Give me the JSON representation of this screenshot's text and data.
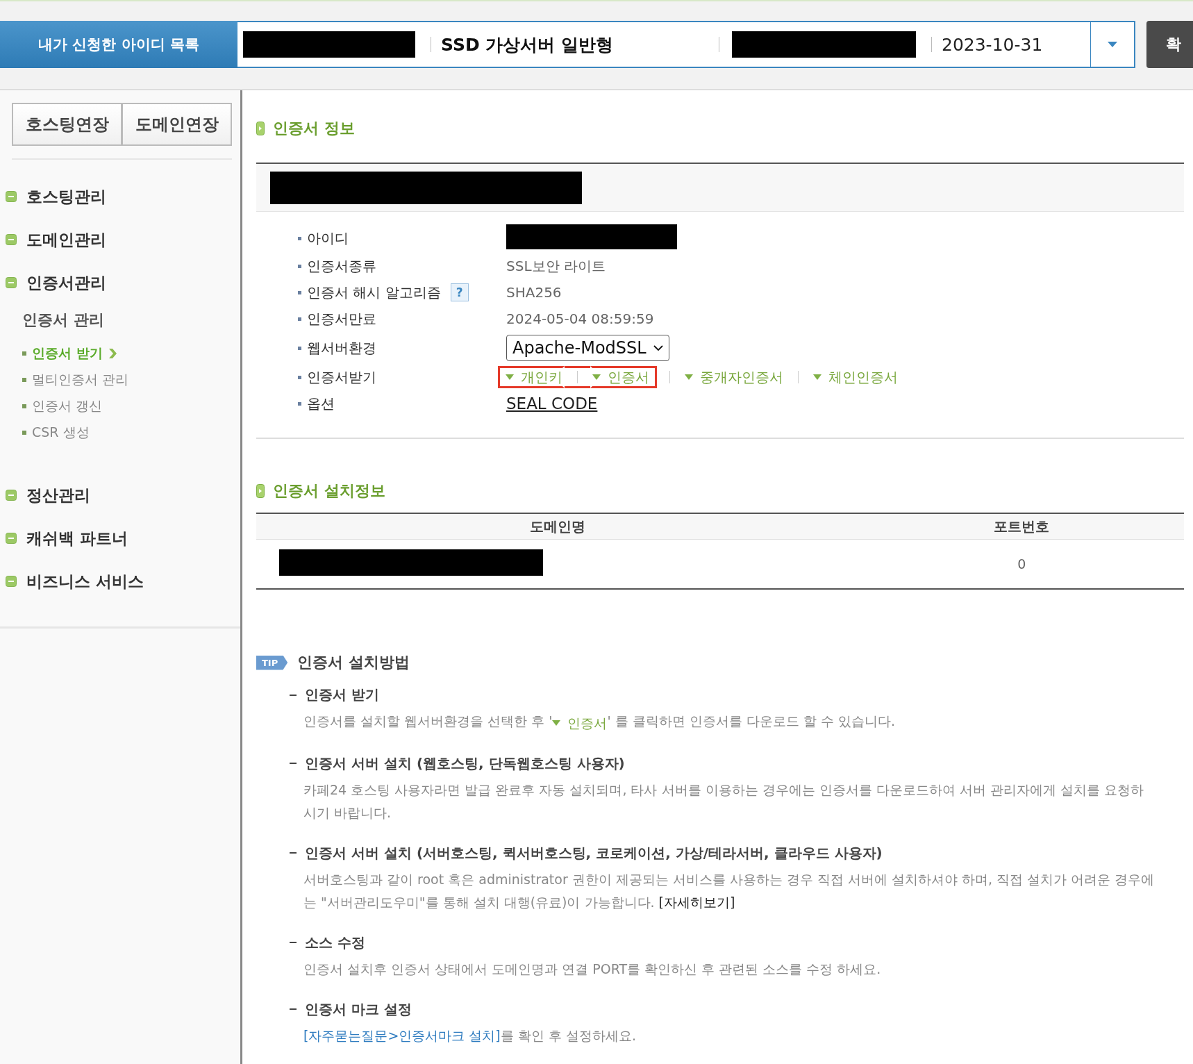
{
  "header": {
    "label": "내가 신청한 아이디 목록",
    "product": "SSD 가상서버 일반형",
    "date": "2023-10-31",
    "confirm_button": "확"
  },
  "sidebar": {
    "buttons": [
      "호스팅연장",
      "도메인연장"
    ],
    "menu": [
      {
        "label": "호스팅관리"
      },
      {
        "label": "도메인관리"
      },
      {
        "label": "인증서관리",
        "sub_heading": "인증서 관리",
        "children": [
          {
            "label": "인증서 받기",
            "selected": true
          },
          {
            "label": "멀티인증서 관리",
            "selected": false
          },
          {
            "label": "인증서 갱신",
            "selected": false
          },
          {
            "label": "CSR 생성",
            "selected": false
          }
        ]
      },
      {
        "label": "정산관리"
      },
      {
        "label": "캐쉬백 파트너"
      },
      {
        "label": "비즈니스 서비스"
      }
    ]
  },
  "cert_info": {
    "title": "인증서 정보",
    "rows": [
      {
        "label": "아이디",
        "kind": "redacted"
      },
      {
        "label": "인증서종류",
        "kind": "text",
        "value": "SSL보안 라이트"
      },
      {
        "label": "인증서 해시 알고리즘",
        "help": "?",
        "kind": "text",
        "value": "SHA256"
      },
      {
        "label": "인증서만료",
        "kind": "text",
        "value": "2024-05-04 08:59:59"
      },
      {
        "label": "웹서버환경",
        "kind": "select",
        "value": "Apache-ModSSL"
      },
      {
        "label": "인증서받기",
        "kind": "downloads",
        "links": [
          {
            "label": "개인키",
            "highlighted": true
          },
          {
            "label": "인증서",
            "highlighted": true
          },
          {
            "label": "중개자인증서",
            "highlighted": false
          },
          {
            "label": "체인인증서",
            "highlighted": false
          }
        ]
      },
      {
        "label": "옵션",
        "kind": "link",
        "value": "SEAL CODE"
      }
    ]
  },
  "install_info": {
    "title": "인증서 설치정보",
    "columns": [
      "도메인명",
      "포트번호"
    ],
    "rows": [
      {
        "port": "0"
      }
    ]
  },
  "tip": {
    "badge": "TIP",
    "title": "인증서 설치방법",
    "items": [
      {
        "title": "인증서 받기",
        "body": [
          {
            "kind": "text",
            "text": "인증서를 설치할 웹서버환경을 선택한 후 '"
          },
          {
            "kind": "download",
            "text": "인증서"
          },
          {
            "kind": "text",
            "text": "' 를 클릭하면 인증서를 다운로드 할 수 있습니다."
          }
        ]
      },
      {
        "title": "인증서 서버 설치 (웹호스팅, 단독웹호스팅 사용자)",
        "body": [
          {
            "kind": "text",
            "text": "카페24 호스팅 사용자라면 발급 완료후 자동 설치되며, 타사 서버를 이용하는 경우에는 인증서를 다운로드하여 서버 관리자에게 설치를 요청하시기 바랍니다."
          }
        ]
      },
      {
        "title": "인증서 서버 설치 (서버호스팅, 퀵서버호스팅, 코로케이션, 가상/테라서버, 클라우드 사용자)",
        "body": [
          {
            "kind": "text",
            "text": "서버호스팅과 같이 root 혹은 administrator 권한이 제공되는 서비스를 사용하는 경우 직접 서버에 설치하셔야 하며, 직접 설치가 어려운 경우에는 \"서버관리도우미\"를 통해 설치 대행(유료)이 가능합니다. "
          },
          {
            "kind": "link",
            "text": "[자세히보기]"
          }
        ]
      },
      {
        "title": "소스 수정",
        "body": [
          {
            "kind": "text",
            "text": "인증서 설치후 인증서 상태에서 도메인명과 연결 PORT를 확인하신 후 관련된 소스를 수정 하세요."
          }
        ]
      },
      {
        "title": "인증서 마크 설정",
        "body": [
          {
            "kind": "faq",
            "text": "[자주묻는질문>인증서마크 설치]"
          },
          {
            "kind": "text",
            "text": "를 확인 후 설정하세요."
          }
        ]
      }
    ]
  }
}
